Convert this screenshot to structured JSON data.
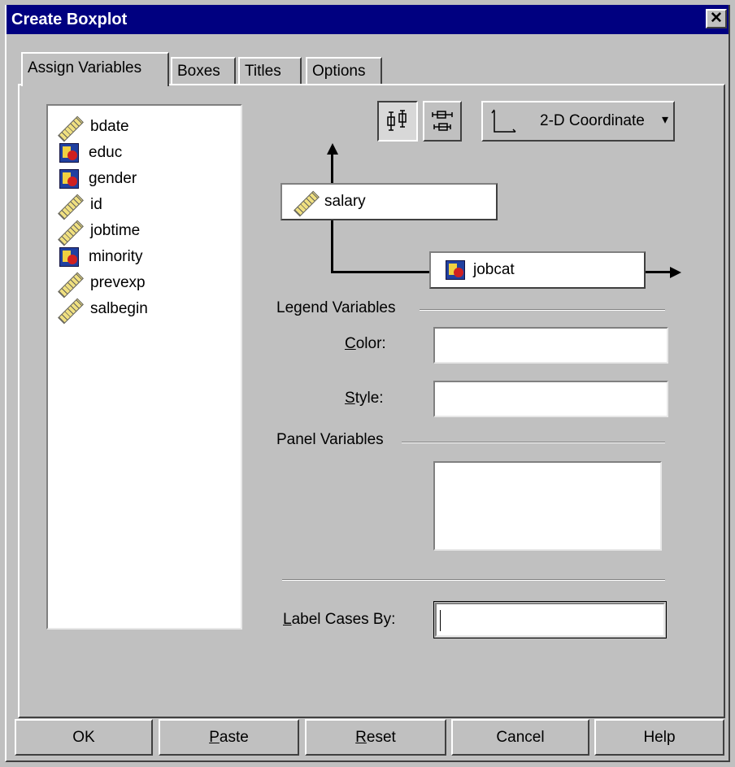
{
  "window": {
    "title": "Create Boxplot",
    "close_label": "✕"
  },
  "tabs": [
    {
      "label": "Assign Variables",
      "active": true
    },
    {
      "label": "Boxes",
      "active": false
    },
    {
      "label": "Titles",
      "active": false
    },
    {
      "label": "Options",
      "active": false
    }
  ],
  "variables": [
    {
      "label": "bdate",
      "icon": "scale-ruler-icon"
    },
    {
      "label": "educ",
      "icon": "nominal-variable-icon"
    },
    {
      "label": "gender",
      "icon": "nominal-variable-icon"
    },
    {
      "label": "id",
      "icon": "scale-ruler-icon"
    },
    {
      "label": "jobtime",
      "icon": "scale-ruler-icon"
    },
    {
      "label": "minority",
      "icon": "nominal-variable-icon"
    },
    {
      "label": "prevexp",
      "icon": "scale-ruler-icon"
    },
    {
      "label": "salbegin",
      "icon": "scale-ruler-icon"
    }
  ],
  "toolbar": {
    "coordinate_label": "2-D Coordinate",
    "coordinate_caret": "▾"
  },
  "axes": {
    "y_variable": "salary",
    "x_variable": "jobcat"
  },
  "legend": {
    "heading": "Legend Variables",
    "color_label_u": "C",
    "color_label_rest": "olor:",
    "color_value": "",
    "style_label_u": "S",
    "style_label_rest": "tyle:",
    "style_value": ""
  },
  "panel": {
    "heading": "Panel Variables",
    "value": ""
  },
  "label_cases": {
    "label_u": "L",
    "label_rest": "abel Cases By:",
    "value": ""
  },
  "buttons": {
    "ok": "OK",
    "paste_u": "P",
    "paste_rest": "aste",
    "reset_u": "R",
    "reset_rest": "eset",
    "cancel": "Cancel",
    "help": "Help"
  },
  "colors": {
    "titlebar": "#000080",
    "face": "#c0c0c0"
  }
}
